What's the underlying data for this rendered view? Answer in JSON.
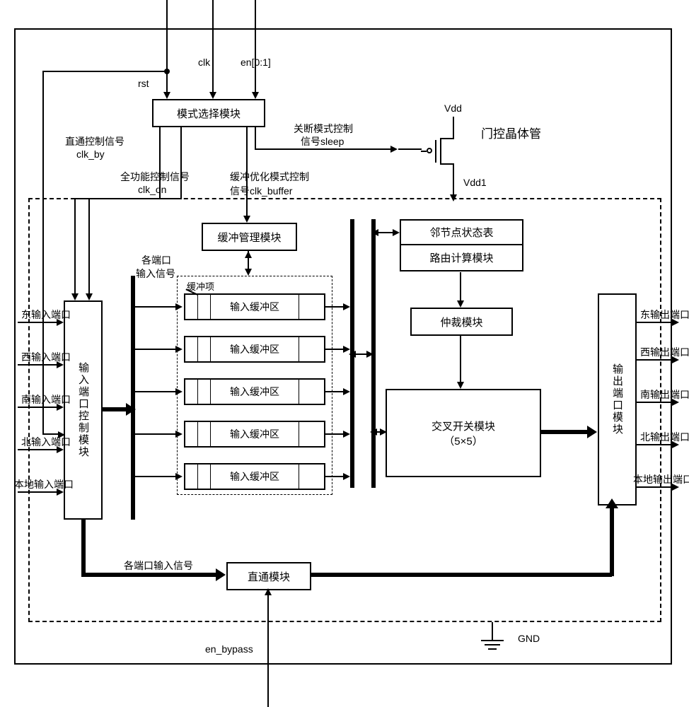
{
  "signals": {
    "rst": "rst",
    "clk": "clk",
    "en": "en[0:1]",
    "vdd": "Vdd",
    "vdd1": "Vdd1",
    "gnd": "GND",
    "en_bypass": "en_bypass"
  },
  "labels": {
    "mode_select": "模式选择模块",
    "direct_ctrl": "直通控制信号",
    "clk_by": "clk_by",
    "full_ctrl": "全功能控制信号",
    "clk_on": "clk_on",
    "shutdown_ctrl": "关断模式控制",
    "signal_sleep": "信号sleep",
    "buffer_opt_ctrl": "缓冲优化模式控制",
    "signal_clk_buffer": "信号clk_buffer",
    "gate_transistor": "门控晶体管",
    "buffer_mgmt": "缓冲管理模块",
    "neighbor_table": "邻节点状态表",
    "route_calc": "路由计算模块",
    "arbitration": "仲裁模块",
    "crossbar": "交叉开关模块",
    "crossbar_size": "（5×5）",
    "input_port_ctrl": "输入端口控制模块",
    "output_port": "输出端口模块",
    "direct_module": "直通模块",
    "port_input_signal": "各端口",
    "port_input_signal2": "输入信号",
    "port_input_signal_h": "各端口输入信号",
    "buffer_item": "缓冲项",
    "input_buffer": "输入缓冲区"
  },
  "input_ports": [
    "东输入端口",
    "西输入端口",
    "南输入端口",
    "北输入端口",
    "本地输入端口"
  ],
  "output_ports": [
    "东输出端口",
    "西输出端口",
    "南输出端口",
    "北输出端口",
    "本地输出端口"
  ]
}
